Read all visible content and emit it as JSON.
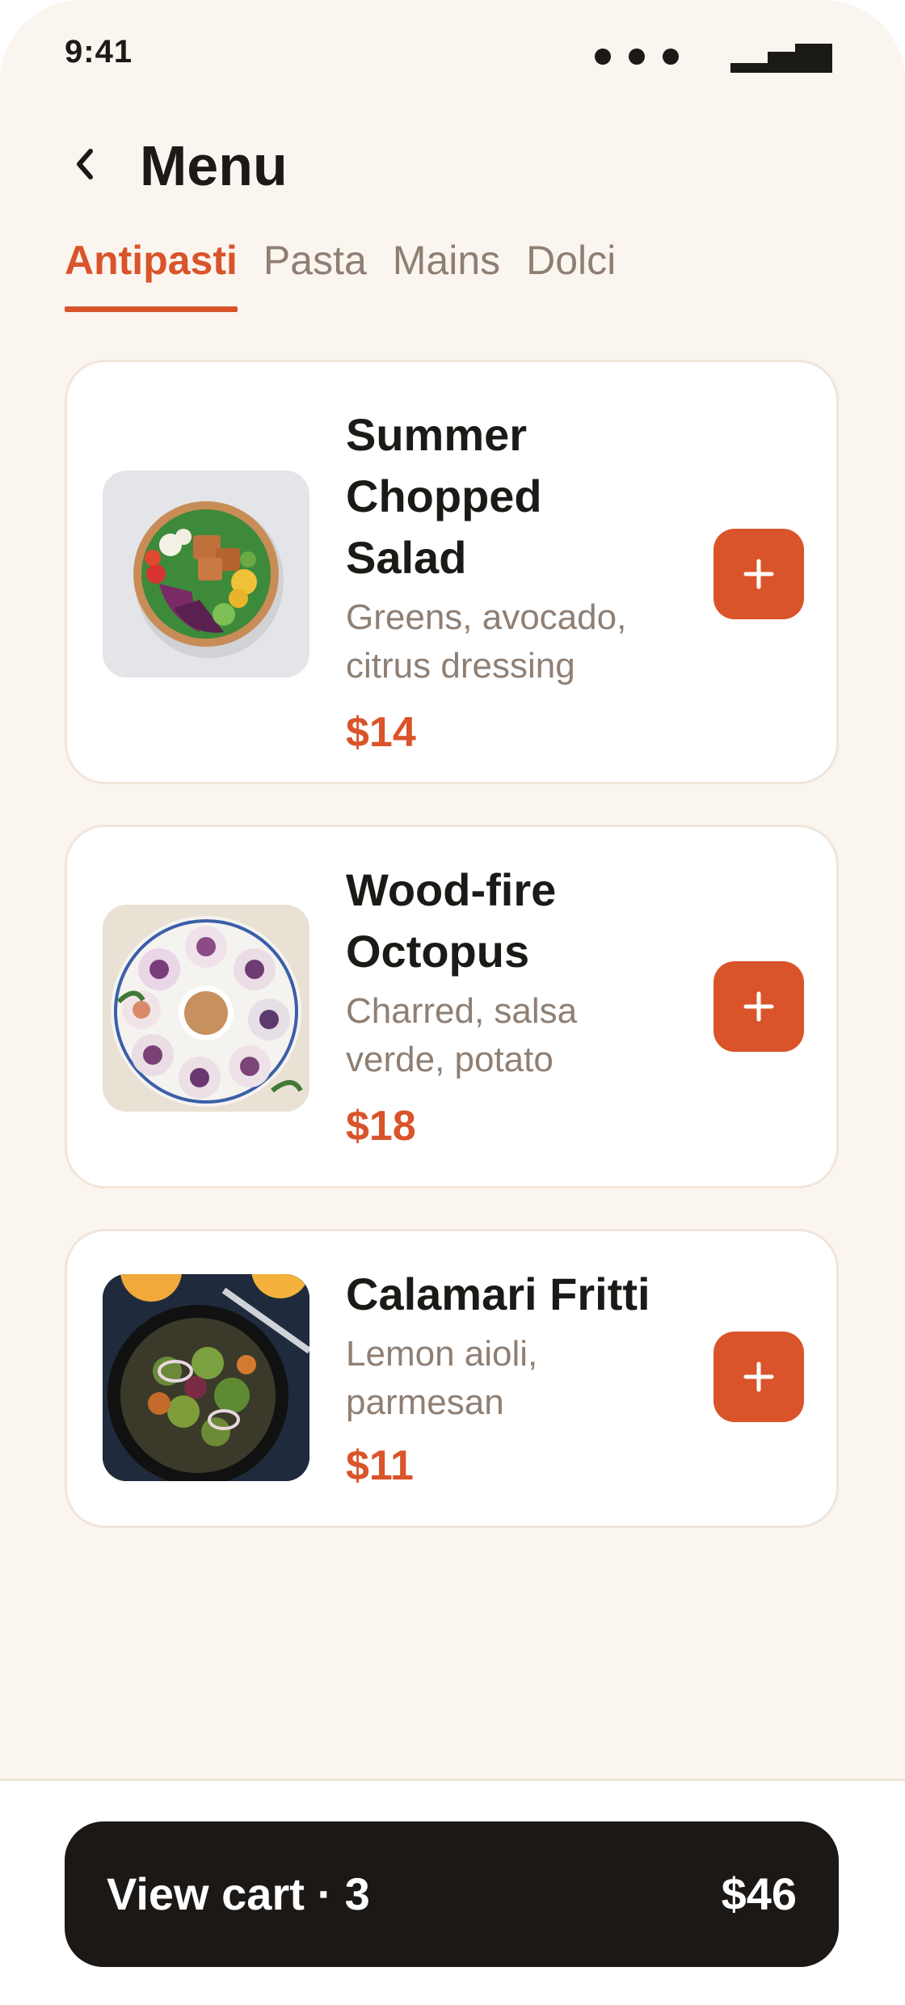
{
  "status_bar": {
    "time": "9:41"
  },
  "header": {
    "title": "Menu",
    "back_icon": "chevron-left-icon"
  },
  "tabs": [
    {
      "label": "Antipasti",
      "active": true
    },
    {
      "label": "Pasta",
      "active": false
    },
    {
      "label": "Mains",
      "active": false
    },
    {
      "label": "Dolci",
      "active": false
    }
  ],
  "items": [
    {
      "name": "Summer Chopped Salad",
      "description": "Greens, avocado, citrus dressing",
      "price": "$14",
      "add_label": "+"
    },
    {
      "name": "Wood-fire Octopus",
      "description": "Charred, salsa verde, potato",
      "price": "$18",
      "add_label": "+"
    },
    {
      "name": "Calamari Fritti",
      "description": "Lemon aioli, parmesan",
      "price": "$11",
      "add_label": "+"
    }
  ],
  "cart": {
    "label": "View cart · 3",
    "total": "$46"
  },
  "colors": {
    "accent": "#d9542a",
    "background": "#fbf5ef",
    "text": "#1b1a17",
    "muted": "#8f7f73",
    "cart_bg": "#1b1816"
  }
}
